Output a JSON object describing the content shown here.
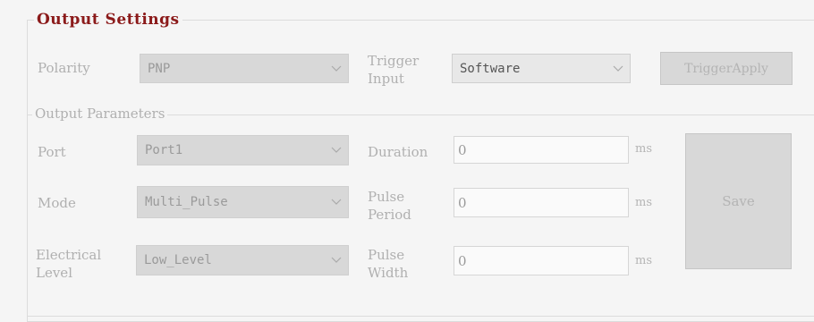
{
  "output_settings": {
    "title": "Output Settings",
    "polarity_label": "Polarity",
    "polarity_value": "PNP",
    "trigger_input_label_line1": "Trigger",
    "trigger_input_label_line2": "Input",
    "trigger_input_value": "Software",
    "trigger_apply_label": "TriggerApply"
  },
  "output_parameters": {
    "title": "Output Parameters",
    "port_label": "Port",
    "port_value": "Port1",
    "mode_label": "Mode",
    "mode_value": "Multi_Pulse",
    "electrical_level_label_line1": "Electrical",
    "electrical_level_label_line2": "Level",
    "electrical_level_value": "Low_Level",
    "duration_label": "Duration",
    "duration_value": "0",
    "duration_unit": "ms",
    "pulse_period_label_line1": "Pulse",
    "pulse_period_label_line2": "Period",
    "pulse_period_value": "0",
    "pulse_period_unit": "ms",
    "pulse_width_label_line1": "Pulse",
    "pulse_width_label_line2": "Width",
    "pulse_width_value": "0",
    "pulse_width_unit": "ms",
    "save_label": "Save"
  },
  "colors": {
    "title_accent": "#8b1a1a",
    "background": "#f5f5f5",
    "disabled_text": "#a9a9a9",
    "combo_fill": "#d8d8d8"
  },
  "icons": {
    "dropdown": "chevron-down-icon"
  }
}
